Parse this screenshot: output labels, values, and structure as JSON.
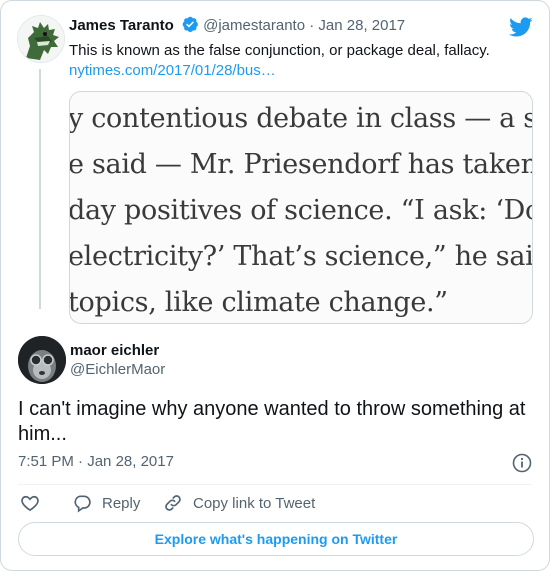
{
  "quoted_tweet": {
    "author_name": "James Taranto",
    "author_handle": "@jamestaranto",
    "separator": "·",
    "date": "Jan 28, 2017",
    "text": "This is known as the false conjunction, or package deal, fallacy.",
    "link": "nytimes.com/2017/01/28/bus…",
    "image_text_lines": [
      "y contentious debate in class — a st",
      "e said — Mr. Priesendorf has taken",
      "day positives of science. “I ask: ‘Do",
      "electricity?’ That’s science,” he said",
      "topics, like climate change.”"
    ]
  },
  "tweet": {
    "author_name": "maor eichler",
    "author_handle": "@EichlerMaor",
    "text": "I can't imagine why anyone wanted to throw something at him...",
    "time": "7:51 PM",
    "separator": "·",
    "date": "Jan 28, 2017"
  },
  "actions": {
    "reply_label": "Reply",
    "copy_link_label": "Copy link to Tweet"
  },
  "explore_label": "Explore what's happening on Twitter",
  "icons": [
    "twitter-bird-icon",
    "verified-badge-icon",
    "info-icon",
    "heart-icon",
    "reply-icon",
    "link-icon"
  ],
  "colors": {
    "accent": "#1d9bf0",
    "secondary_text": "#536471",
    "border": "#cfd9de"
  }
}
